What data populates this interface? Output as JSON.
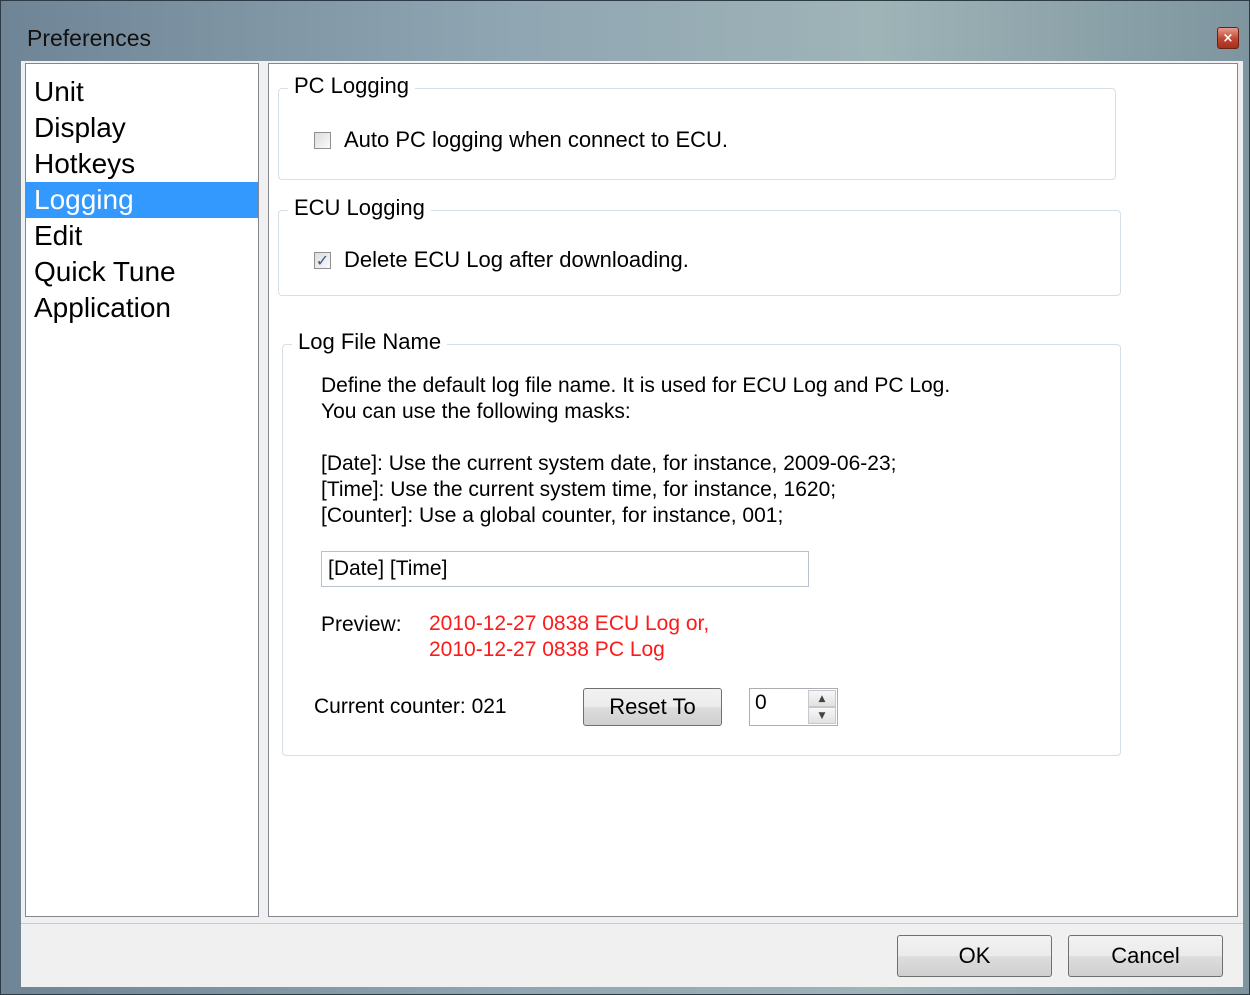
{
  "window": {
    "title": "Preferences",
    "close_glyph": "×"
  },
  "nav": {
    "items": [
      {
        "label": "Unit"
      },
      {
        "label": "Display"
      },
      {
        "label": "Hotkeys"
      },
      {
        "label": "Logging"
      },
      {
        "label": "Edit"
      },
      {
        "label": "Quick Tune"
      },
      {
        "label": "Application"
      }
    ],
    "selected": "Logging"
  },
  "pc_logging": {
    "legend": "PC Logging",
    "checkbox_label": "Auto PC logging when connect to ECU.",
    "checked": false
  },
  "ecu_logging": {
    "legend": "ECU Logging",
    "checkbox_label": "Delete ECU Log after downloading.",
    "checked": true,
    "check_glyph": "✓"
  },
  "log_file_name": {
    "legend": "Log File Name",
    "desc_line1": "Define the default log file name. It is used for ECU Log and PC Log.",
    "desc_line2": "You can use the following masks:",
    "mask_date": "[Date]: Use the current system date, for instance, 2009-06-23;",
    "mask_time": "[Time]: Use the current system time, for instance, 1620;",
    "mask_counter": "[Counter]: Use a global counter, for instance, 001;",
    "pattern_value": "[Date] [Time]",
    "preview_label": "Preview:",
    "preview_line1": "2010-12-27 0838 ECU Log or,",
    "preview_line2": "2010-12-27 0838 PC Log",
    "preview_color": "#ff1a1a",
    "current_counter": "Current counter: 021",
    "reset_button": "Reset To",
    "reset_value": "0",
    "spin_up_glyph": "▲",
    "spin_down_glyph": "▼"
  },
  "footer": {
    "ok": "OK",
    "cancel": "Cancel"
  },
  "colors": {
    "selection": "#3399ff"
  }
}
